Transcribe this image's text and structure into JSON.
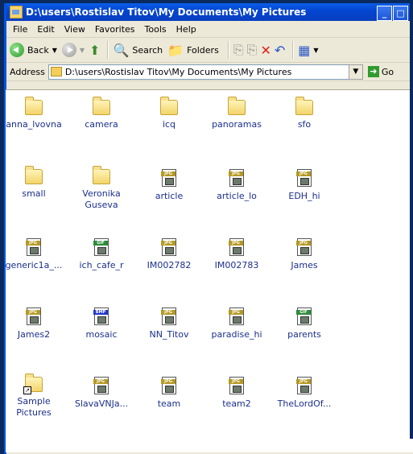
{
  "window": {
    "title": "D:\\users\\Rostislav Titov\\My Documents\\My Pictures",
    "minimize": "_",
    "maximize": "□"
  },
  "menu": [
    "File",
    "Edit",
    "View",
    "Favorites",
    "Tools",
    "Help"
  ],
  "toolbar": {
    "back": "Back",
    "search": "Search",
    "folders": "Folders"
  },
  "address": {
    "label": "Address",
    "value": "D:\\users\\Rostislav Titov\\My Documents\\My Pictures",
    "go": "Go"
  },
  "items": [
    {
      "label": "anna_lvovna",
      "type": "folder"
    },
    {
      "label": "camera",
      "type": "folder"
    },
    {
      "label": "icq",
      "type": "folder"
    },
    {
      "label": "panoramas",
      "type": "folder"
    },
    {
      "label": "sfo",
      "type": "folder"
    },
    {
      "label": "small",
      "type": "folder"
    },
    {
      "label": "Veronika Guseva",
      "type": "folder"
    },
    {
      "label": "article",
      "type": "JPG"
    },
    {
      "label": "article_lo",
      "type": "JPG"
    },
    {
      "label": "EDH_hi",
      "type": "JPG"
    },
    {
      "label": "generic1a_...",
      "type": "JPG"
    },
    {
      "label": "ich_cafe_r",
      "type": "GIF"
    },
    {
      "label": "IM002782",
      "type": "JPG"
    },
    {
      "label": "IM002783",
      "type": "JPG"
    },
    {
      "label": "James",
      "type": "JPG"
    },
    {
      "label": "James2",
      "type": "JPG"
    },
    {
      "label": "mosaic",
      "type": "BMP"
    },
    {
      "label": "NN_Titov",
      "type": "JPG"
    },
    {
      "label": "paradise_hi",
      "type": "JPG"
    },
    {
      "label": "parents",
      "type": "GIF"
    },
    {
      "label": "Sample Pictures",
      "type": "shortcut-folder"
    },
    {
      "label": "SlavaVNJa...",
      "type": "JPG"
    },
    {
      "label": "team",
      "type": "JPG"
    },
    {
      "label": "team2",
      "type": "JPG"
    },
    {
      "label": "TheLordOf...",
      "type": "JPG"
    }
  ],
  "colors": {
    "jpg_tag": "#b59a25",
    "gif_tag": "#2e8b3a",
    "bmp_tag": "#2437c9",
    "titlebar": "#0a5ee8"
  }
}
